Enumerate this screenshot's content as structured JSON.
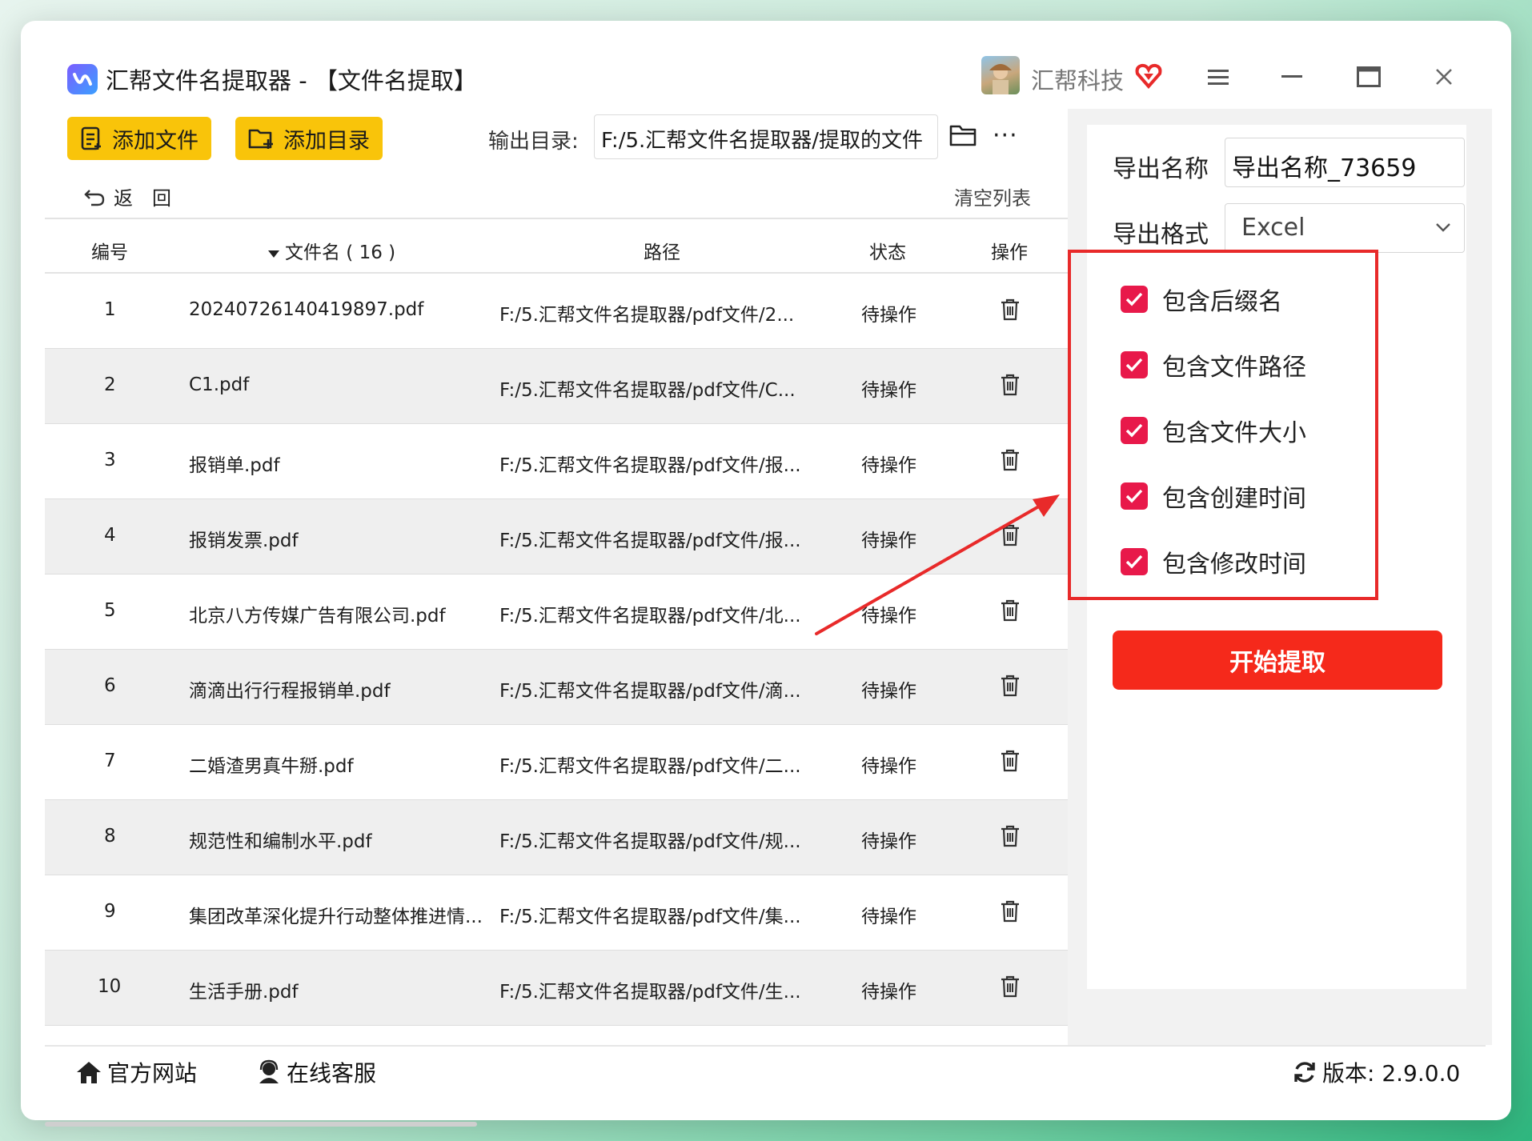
{
  "app": {
    "title": "汇帮文件名提取器 - 【文件名提取】",
    "user_name": "汇帮科技"
  },
  "toolbar": {
    "add_file_label": "添加文件",
    "add_dir_label": "添加目录",
    "output_dir_label": "输出目录:",
    "output_dir_value": "F:/5.汇帮文件名提取器/提取的文件",
    "more_label": "···",
    "back_label": "返　回",
    "clear_list_label": "清空列表"
  },
  "table": {
    "headers": {
      "index": "编号",
      "filename": "文件名 ( 16 )",
      "path": "路径",
      "status": "状态",
      "action": "操作"
    },
    "rows": [
      {
        "index": "1",
        "filename": "20240726140419897.pdf",
        "path": "F:/5.汇帮文件名提取器/pdf文件/2...",
        "status": "待操作"
      },
      {
        "index": "2",
        "filename": "C1.pdf",
        "path": "F:/5.汇帮文件名提取器/pdf文件/C...",
        "status": "待操作"
      },
      {
        "index": "3",
        "filename": "报销单.pdf",
        "path": "F:/5.汇帮文件名提取器/pdf文件/报...",
        "status": "待操作"
      },
      {
        "index": "4",
        "filename": "报销发票.pdf",
        "path": "F:/5.汇帮文件名提取器/pdf文件/报...",
        "status": "待操作"
      },
      {
        "index": "5",
        "filename": "北京八方传媒广告有限公司.pdf",
        "path": "F:/5.汇帮文件名提取器/pdf文件/北...",
        "status": "待操作"
      },
      {
        "index": "6",
        "filename": "滴滴出行行程报销单.pdf",
        "path": "F:/5.汇帮文件名提取器/pdf文件/滴...",
        "status": "待操作"
      },
      {
        "index": "7",
        "filename": "二婚渣男真牛掰.pdf",
        "path": "F:/5.汇帮文件名提取器/pdf文件/二...",
        "status": "待操作"
      },
      {
        "index": "8",
        "filename": "规范性和编制水平.pdf",
        "path": "F:/5.汇帮文件名提取器/pdf文件/规...",
        "status": "待操作"
      },
      {
        "index": "9",
        "filename": "集团改革深化提升行动整体推进情...",
        "path": "F:/5.汇帮文件名提取器/pdf文件/集...",
        "status": "待操作"
      },
      {
        "index": "10",
        "filename": "生活手册.pdf",
        "path": "F:/5.汇帮文件名提取器/pdf文件/生...",
        "status": "待操作"
      }
    ]
  },
  "settings": {
    "export_name_label": "导出名称",
    "export_name_value": "导出名称_73659",
    "export_format_label": "导出格式",
    "export_format_value": "Excel",
    "options": [
      {
        "label": "包含后缀名",
        "checked": true
      },
      {
        "label": "包含文件路径",
        "checked": true
      },
      {
        "label": "包含文件大小",
        "checked": true
      },
      {
        "label": "包含创建时间",
        "checked": true
      },
      {
        "label": "包含修改时间",
        "checked": true
      }
    ],
    "start_button_label": "开始提取"
  },
  "footer": {
    "website_label": "官方网站",
    "support_label": "在线客服",
    "version_label": "版本: 2.9.0.0"
  },
  "colors": {
    "accent_yellow": "#f9c40a",
    "checkbox_pink": "#e8194a",
    "start_red": "#f5291b",
    "highlight_red": "#e82a2a"
  },
  "icons": [
    "app-logo-icon",
    "vip-heart-icon",
    "menu-icon",
    "minimize-icon",
    "maximize-icon",
    "close-icon",
    "add-file-icon",
    "add-folder-icon",
    "folder-icon",
    "more-icon",
    "back-icon",
    "sort-down-icon",
    "trash-icon",
    "chevron-down-icon",
    "check-icon",
    "home-icon",
    "support-icon",
    "refresh-icon"
  ]
}
